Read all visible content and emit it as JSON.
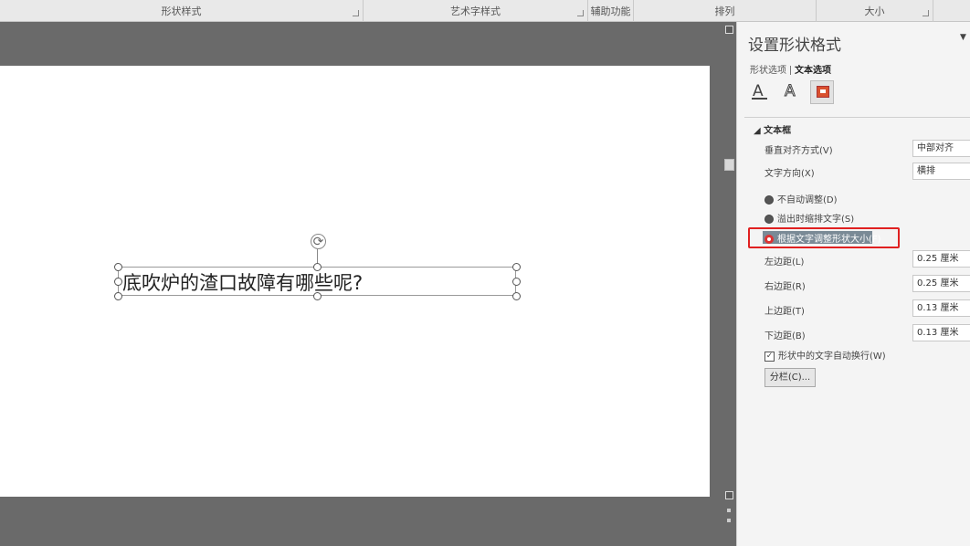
{
  "ribbon": {
    "groups": [
      {
        "label": "形状样式"
      },
      {
        "label": "艺术字样式"
      },
      {
        "label": "辅助功能"
      },
      {
        "label": "排列"
      },
      {
        "label": "大小"
      }
    ]
  },
  "slide": {
    "textbox_text": "底吹炉的渣口故障有哪些呢?"
  },
  "pane": {
    "title": "设置形状格式",
    "tabs": [
      "形状选项",
      "文本选项"
    ],
    "icons": [
      "text-fill-outline-icon",
      "text-effects-icon",
      "text-box-layout-icon"
    ],
    "section": "文本框",
    "vertical_align_label": "垂直对齐方式(V)",
    "vertical_align_value": "中部对齐",
    "text_direction_label": "文字方向(X)",
    "text_direction_value": "横排",
    "autofit": [
      {
        "label": "不自动调整(D)",
        "selected": false
      },
      {
        "label": "溢出时缩排文字(S)",
        "selected": false
      },
      {
        "label": "根据文字调整形状大小(F)",
        "selected": true
      }
    ],
    "margins": [
      {
        "label": "左边距(L)",
        "value": "0.25 厘米"
      },
      {
        "label": "右边距(R)",
        "value": "0.25 厘米"
      },
      {
        "label": "上边距(T)",
        "value": "0.13 厘米"
      },
      {
        "label": "下边距(B)",
        "value": "0.13 厘米"
      }
    ],
    "wrap_label": "形状中的文字自动换行(W)",
    "wrap_checked": true,
    "columns_button": "分栏(C)..."
  },
  "colors": {
    "highlight": "#e02020",
    "workspace": "#6a6a6a",
    "pane": "#f4f4f4"
  }
}
